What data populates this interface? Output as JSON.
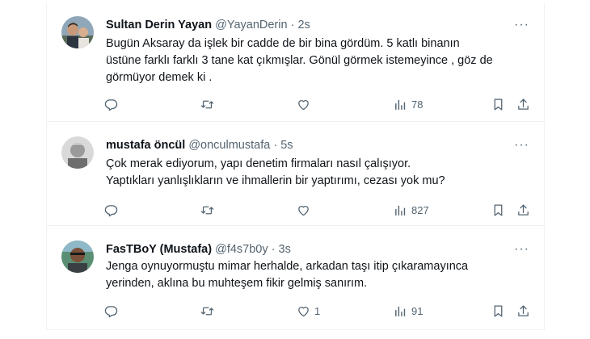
{
  "tweets": [
    {
      "name": "Sultan Derin Yayan",
      "handle": "@YayanDerin",
      "time": "2s",
      "lines": [
        "Bugün Aksaray da işlek bir cadde de bir bina gördüm. 5 katlı binanın",
        "üstüne farklı farklı 3 tane kat çıkmışlar. Gönül görmek istemeyince , göz de",
        "görmüyor demek ki ."
      ],
      "likes": "",
      "views": "78"
    },
    {
      "name": "mustafa öncül",
      "handle": "@onculmustafa",
      "time": "5s",
      "lines": [
        "Çok merak ediyorum, yapı denetim firmaları nasıl çalışıyor.",
        "Yaptıkları yanlışlıkların ve ihmallerin bir yaptırımı, cezası yok mu?"
      ],
      "likes": "",
      "views": "827"
    },
    {
      "name": "FasTBoY (Mustafa)",
      "handle": "@f4s7b0y",
      "time": "3s",
      "lines": [
        "Jenga oynuyormuştu mimar herhalde, arkadan taşı itip çıkaramayınca",
        "yerinden, aklına bu muhteşem fikir gelmiş sanırım."
      ],
      "likes": "1",
      "views": "91"
    }
  ],
  "separator": "·",
  "more_glyph": "···",
  "colors": {
    "text": "#0f1419",
    "secondary": "#536471",
    "border": "#eff3f4"
  },
  "icons": [
    "reply-icon",
    "retweet-icon",
    "like-icon",
    "views-icon",
    "bookmark-icon",
    "share-icon",
    "more-icon"
  ]
}
